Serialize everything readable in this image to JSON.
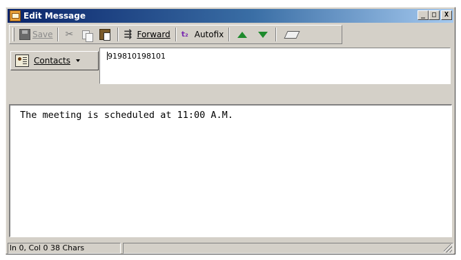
{
  "window": {
    "title": "Edit Message",
    "minimize": "_",
    "maximize": "□",
    "close": "X"
  },
  "toolbar": {
    "save_label": "Save",
    "forward_label": "Forward",
    "autofix_label": "Autofix",
    "icons": [
      "save-icon",
      "cut-icon",
      "copy-icon",
      "paste-icon",
      "forward-icon",
      "autofix-icon",
      "up-arrow-icon",
      "down-arrow-icon",
      "eraser-icon"
    ]
  },
  "recipients": {
    "contacts_label": "Contacts",
    "value": "919810198101"
  },
  "message": {
    "body": "The meeting is scheduled at 11:00 A.M."
  },
  "status": {
    "position_text": "ln 0, Col 0  38 Chars"
  },
  "colors": {
    "titlebar_start": "#0a246a",
    "titlebar_end": "#a6caf0",
    "window_face": "#d4d0c8",
    "arrow_green": "#1e8a2c"
  }
}
